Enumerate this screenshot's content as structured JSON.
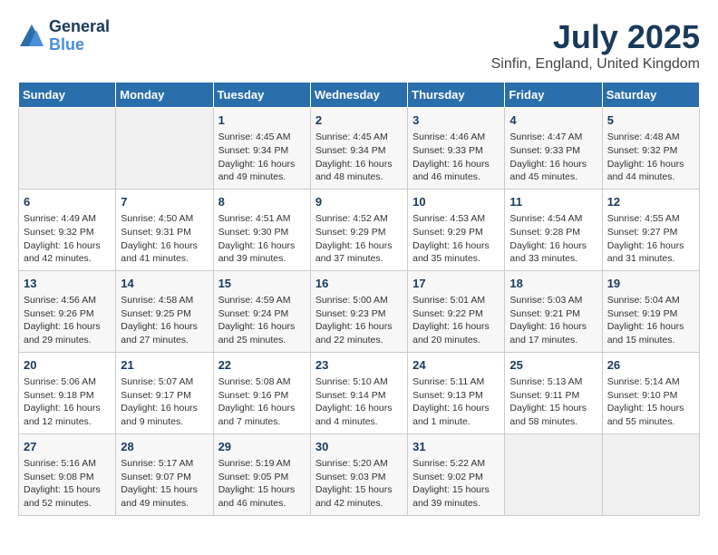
{
  "logo": {
    "line1": "General",
    "line2": "Blue"
  },
  "title": "July 2025",
  "subtitle": "Sinfin, England, United Kingdom",
  "headers": [
    "Sunday",
    "Monday",
    "Tuesday",
    "Wednesday",
    "Thursday",
    "Friday",
    "Saturday"
  ],
  "weeks": [
    [
      {
        "day": "",
        "info": ""
      },
      {
        "day": "",
        "info": ""
      },
      {
        "day": "1",
        "info": "Sunrise: 4:45 AM\nSunset: 9:34 PM\nDaylight: 16 hours and 49 minutes."
      },
      {
        "day": "2",
        "info": "Sunrise: 4:45 AM\nSunset: 9:34 PM\nDaylight: 16 hours and 48 minutes."
      },
      {
        "day": "3",
        "info": "Sunrise: 4:46 AM\nSunset: 9:33 PM\nDaylight: 16 hours and 46 minutes."
      },
      {
        "day": "4",
        "info": "Sunrise: 4:47 AM\nSunset: 9:33 PM\nDaylight: 16 hours and 45 minutes."
      },
      {
        "day": "5",
        "info": "Sunrise: 4:48 AM\nSunset: 9:32 PM\nDaylight: 16 hours and 44 minutes."
      }
    ],
    [
      {
        "day": "6",
        "info": "Sunrise: 4:49 AM\nSunset: 9:32 PM\nDaylight: 16 hours and 42 minutes."
      },
      {
        "day": "7",
        "info": "Sunrise: 4:50 AM\nSunset: 9:31 PM\nDaylight: 16 hours and 41 minutes."
      },
      {
        "day": "8",
        "info": "Sunrise: 4:51 AM\nSunset: 9:30 PM\nDaylight: 16 hours and 39 minutes."
      },
      {
        "day": "9",
        "info": "Sunrise: 4:52 AM\nSunset: 9:29 PM\nDaylight: 16 hours and 37 minutes."
      },
      {
        "day": "10",
        "info": "Sunrise: 4:53 AM\nSunset: 9:29 PM\nDaylight: 16 hours and 35 minutes."
      },
      {
        "day": "11",
        "info": "Sunrise: 4:54 AM\nSunset: 9:28 PM\nDaylight: 16 hours and 33 minutes."
      },
      {
        "day": "12",
        "info": "Sunrise: 4:55 AM\nSunset: 9:27 PM\nDaylight: 16 hours and 31 minutes."
      }
    ],
    [
      {
        "day": "13",
        "info": "Sunrise: 4:56 AM\nSunset: 9:26 PM\nDaylight: 16 hours and 29 minutes."
      },
      {
        "day": "14",
        "info": "Sunrise: 4:58 AM\nSunset: 9:25 PM\nDaylight: 16 hours and 27 minutes."
      },
      {
        "day": "15",
        "info": "Sunrise: 4:59 AM\nSunset: 9:24 PM\nDaylight: 16 hours and 25 minutes."
      },
      {
        "day": "16",
        "info": "Sunrise: 5:00 AM\nSunset: 9:23 PM\nDaylight: 16 hours and 22 minutes."
      },
      {
        "day": "17",
        "info": "Sunrise: 5:01 AM\nSunset: 9:22 PM\nDaylight: 16 hours and 20 minutes."
      },
      {
        "day": "18",
        "info": "Sunrise: 5:03 AM\nSunset: 9:21 PM\nDaylight: 16 hours and 17 minutes."
      },
      {
        "day": "19",
        "info": "Sunrise: 5:04 AM\nSunset: 9:19 PM\nDaylight: 16 hours and 15 minutes."
      }
    ],
    [
      {
        "day": "20",
        "info": "Sunrise: 5:06 AM\nSunset: 9:18 PM\nDaylight: 16 hours and 12 minutes."
      },
      {
        "day": "21",
        "info": "Sunrise: 5:07 AM\nSunset: 9:17 PM\nDaylight: 16 hours and 9 minutes."
      },
      {
        "day": "22",
        "info": "Sunrise: 5:08 AM\nSunset: 9:16 PM\nDaylight: 16 hours and 7 minutes."
      },
      {
        "day": "23",
        "info": "Sunrise: 5:10 AM\nSunset: 9:14 PM\nDaylight: 16 hours and 4 minutes."
      },
      {
        "day": "24",
        "info": "Sunrise: 5:11 AM\nSunset: 9:13 PM\nDaylight: 16 hours and 1 minute."
      },
      {
        "day": "25",
        "info": "Sunrise: 5:13 AM\nSunset: 9:11 PM\nDaylight: 15 hours and 58 minutes."
      },
      {
        "day": "26",
        "info": "Sunrise: 5:14 AM\nSunset: 9:10 PM\nDaylight: 15 hours and 55 minutes."
      }
    ],
    [
      {
        "day": "27",
        "info": "Sunrise: 5:16 AM\nSunset: 9:08 PM\nDaylight: 15 hours and 52 minutes."
      },
      {
        "day": "28",
        "info": "Sunrise: 5:17 AM\nSunset: 9:07 PM\nDaylight: 15 hours and 49 minutes."
      },
      {
        "day": "29",
        "info": "Sunrise: 5:19 AM\nSunset: 9:05 PM\nDaylight: 15 hours and 46 minutes."
      },
      {
        "day": "30",
        "info": "Sunrise: 5:20 AM\nSunset: 9:03 PM\nDaylight: 15 hours and 42 minutes."
      },
      {
        "day": "31",
        "info": "Sunrise: 5:22 AM\nSunset: 9:02 PM\nDaylight: 15 hours and 39 minutes."
      },
      {
        "day": "",
        "info": ""
      },
      {
        "day": "",
        "info": ""
      }
    ]
  ]
}
